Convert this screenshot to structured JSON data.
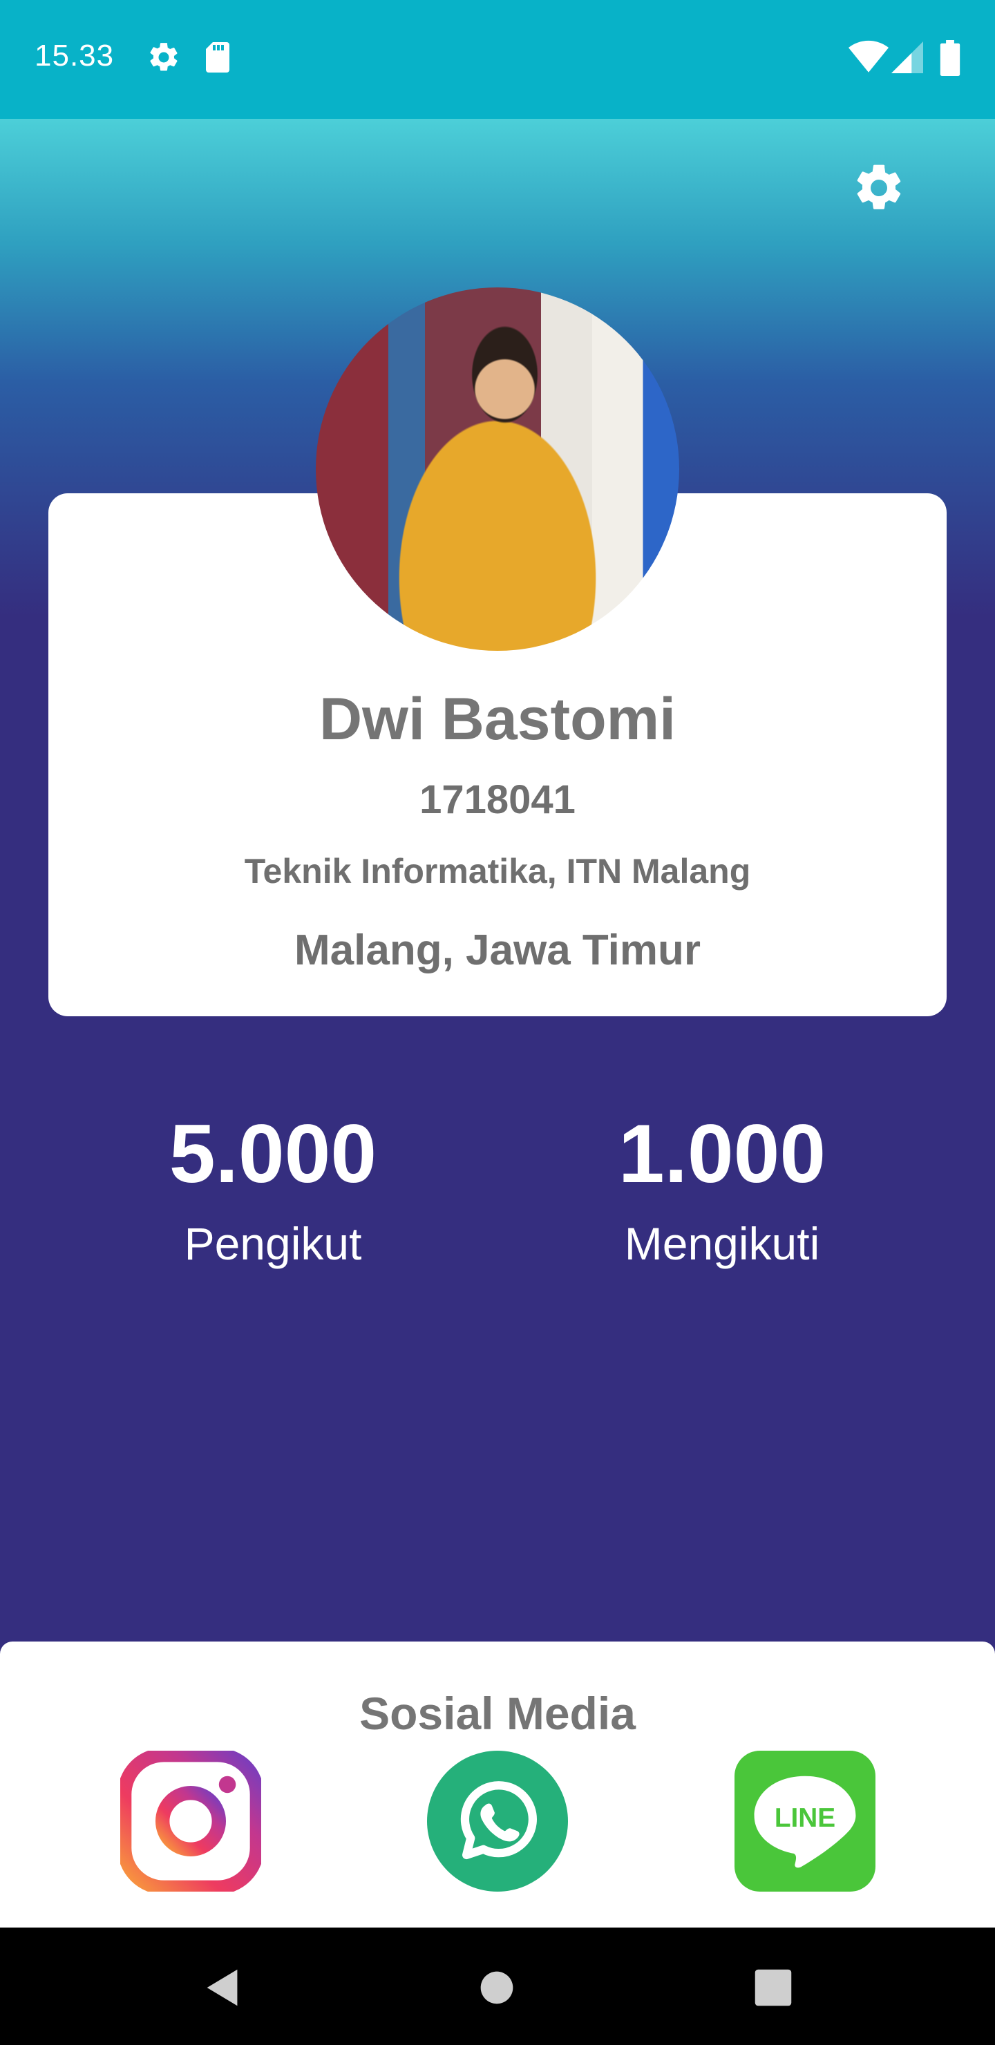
{
  "status_bar": {
    "time": "15.33",
    "icons": [
      "settings-icon",
      "sd-card-icon",
      "wifi-icon",
      "signal-icon",
      "battery-icon"
    ]
  },
  "header": {
    "settings_icon": "gear-icon"
  },
  "profile": {
    "name": "Dwi Bastomi",
    "nim": "1718041",
    "major": "Teknik Informatika, ITN Malang",
    "location": "Malang, Jawa Timur"
  },
  "stats": {
    "followers_count": "5.000",
    "followers_label": "Pengikut",
    "following_count": "1.000",
    "following_label": "Mengikuti"
  },
  "social": {
    "title": "Sosial Media",
    "items": [
      {
        "name": "instagram",
        "icon": "instagram-icon"
      },
      {
        "name": "whatsapp",
        "icon": "whatsapp-icon"
      },
      {
        "name": "line",
        "icon": "line-icon",
        "text": "LINE"
      }
    ]
  },
  "colors": {
    "status_bar": "#08b2c8",
    "primary": "#352e7f",
    "card": "#ffffff",
    "text_gray": "#757575",
    "whatsapp": "#25b07a",
    "line": "#4ac63a"
  },
  "nav_bar": {
    "icons": [
      "back-icon",
      "home-icon",
      "recent-apps-icon"
    ]
  }
}
